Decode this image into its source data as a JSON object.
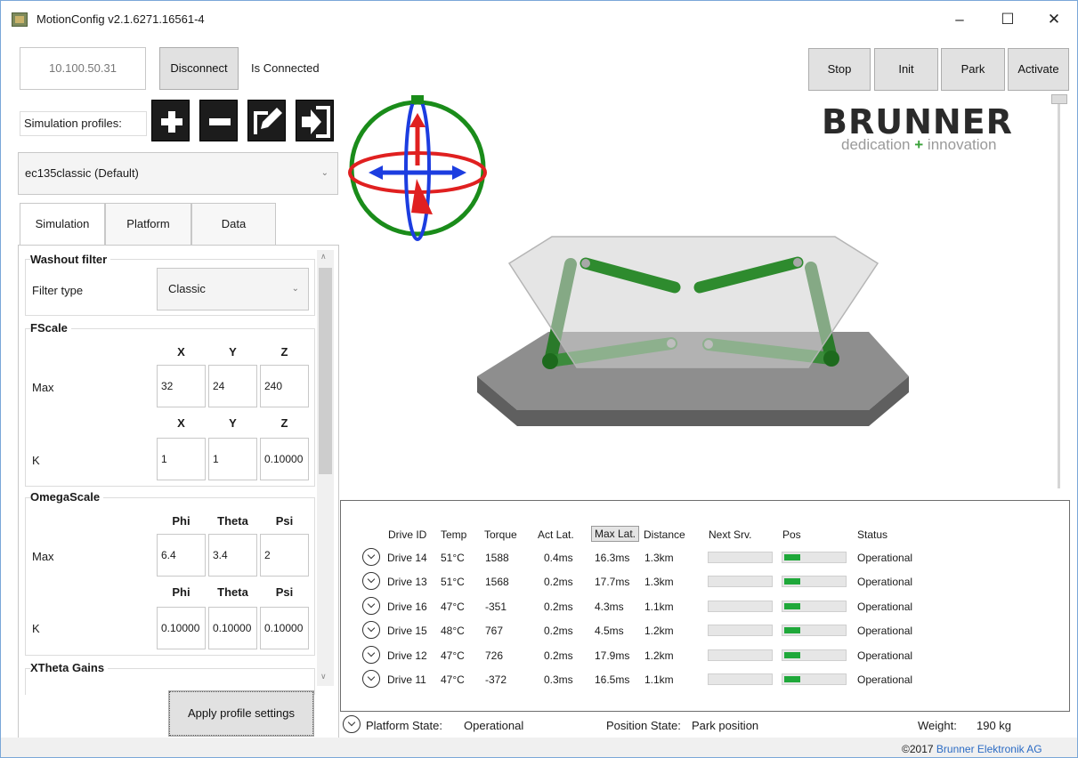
{
  "window": {
    "title": "MotionConfig v2.1.6271.16561-4",
    "min": "–",
    "max": "☐",
    "close": "✕"
  },
  "connection": {
    "ip": "10.100.50.31",
    "disconnect_label": "Disconnect",
    "status": "Is Connected"
  },
  "profiles": {
    "label": "Simulation profiles:",
    "selected": "ec135classic (Default)",
    "buttons": [
      "add-icon",
      "remove-icon",
      "edit-icon",
      "export-icon"
    ]
  },
  "tabs": [
    "Simulation",
    "Platform",
    "Data"
  ],
  "washout": {
    "title": "Washout filter",
    "filter_label": "Filter type",
    "filter_value": "Classic"
  },
  "fscale": {
    "title": "FScale",
    "headers": [
      "X",
      "Y",
      "Z"
    ],
    "max_label": "Max",
    "max": [
      "32",
      "24",
      "240"
    ],
    "k_label": "K",
    "k": [
      "1",
      "1",
      "0.10000"
    ]
  },
  "omegascale": {
    "title": "OmegaScale",
    "headers": [
      "Phi",
      "Theta",
      "Psi"
    ],
    "max_label": "Max",
    "max": [
      "6.4",
      "3.4",
      "2"
    ],
    "k_label": "K",
    "k": [
      "0.10000",
      "0.10000",
      "0.10000"
    ]
  },
  "xtheta": {
    "title": "XTheta Gains"
  },
  "apply_label": "Apply profile settings",
  "controls": {
    "stop": "Stop",
    "init": "Init",
    "park": "Park",
    "activate": "Activate"
  },
  "logo": {
    "word": "BRUNNER",
    "tagline_a": "dedication",
    "tagline_plus": "+",
    "tagline_b": "innovation"
  },
  "drives": {
    "columns": [
      "Drive ID",
      "Temp",
      "Torque",
      "Act Lat.",
      "Max Lat.",
      "Distance",
      "Next Srv.",
      "Pos",
      "Status"
    ],
    "rows": [
      {
        "id": "Drive 14",
        "temp": "51°C",
        "torque": "1588",
        "act_lat": "0.4ms",
        "max_lat": "16.3ms",
        "distance": "1.3km",
        "next_srv": 0.0,
        "pos": 0.26,
        "status": "Operational"
      },
      {
        "id": "Drive 13",
        "temp": "51°C",
        "torque": "1568",
        "act_lat": "0.2ms",
        "max_lat": "17.7ms",
        "distance": "1.3km",
        "next_srv": 0.0,
        "pos": 0.26,
        "status": "Operational"
      },
      {
        "id": "Drive 16",
        "temp": "47°C",
        "torque": "-351",
        "act_lat": "0.2ms",
        "max_lat": "4.3ms",
        "distance": "1.1km",
        "next_srv": 0.0,
        "pos": 0.26,
        "status": "Operational"
      },
      {
        "id": "Drive 15",
        "temp": "48°C",
        "torque": "767",
        "act_lat": "0.2ms",
        "max_lat": "4.5ms",
        "distance": "1.2km",
        "next_srv": 0.0,
        "pos": 0.26,
        "status": "Operational"
      },
      {
        "id": "Drive 12",
        "temp": "47°C",
        "torque": "726",
        "act_lat": "0.2ms",
        "max_lat": "17.9ms",
        "distance": "1.2km",
        "next_srv": 0.0,
        "pos": 0.26,
        "status": "Operational"
      },
      {
        "id": "Drive 11",
        "temp": "47°C",
        "torque": "-372",
        "act_lat": "0.3ms",
        "max_lat": "16.5ms",
        "distance": "1.1km",
        "next_srv": 0.0,
        "pos": 0.26,
        "status": "Operational"
      }
    ]
  },
  "status_bar": {
    "platform_label": "Platform State:",
    "platform_value": "Operational",
    "position_label": "Position State:",
    "position_value": "Park position",
    "weight_label": "Weight:",
    "weight_value": "190 kg"
  },
  "footer": {
    "copyright": "©2017",
    "company": "Brunner Elektronik AG"
  },
  "colors": {
    "accent_green": "#1fa83a",
    "actuator_green": "#2e8b2e",
    "gizmo_red": "#e02020",
    "gizmo_blue": "#1c3de0",
    "gizmo_green": "#1a8c1a",
    "link_blue": "#2b6bc4"
  }
}
